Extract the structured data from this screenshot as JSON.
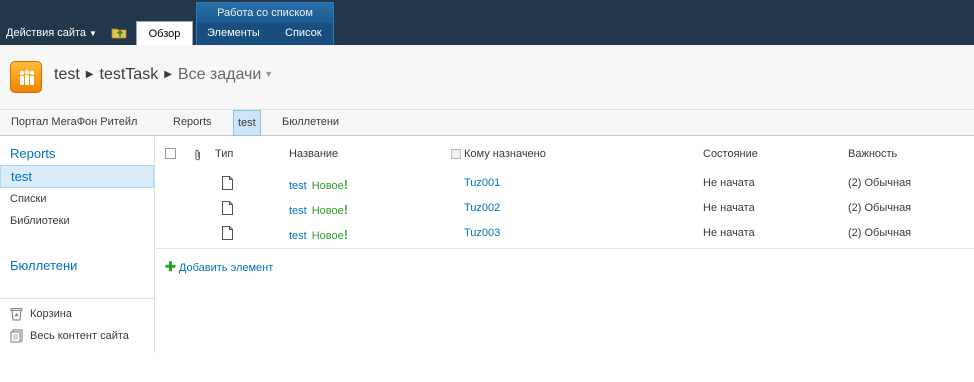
{
  "ribbon": {
    "site_actions": "Действия сайта",
    "browse_tab": "Обзор",
    "context_group": "Работа со списком",
    "context_tabs": [
      "Элементы",
      "Список"
    ]
  },
  "breadcrumb": {
    "site": "test",
    "list": "testTask",
    "view": "Все задачи"
  },
  "topnav": [
    "Портал МегаФон Ритейл",
    "Reports",
    "test",
    "Бюллетени"
  ],
  "quicklaunch": {
    "reports": "Reports",
    "selected": "test",
    "lists": "Списки",
    "libraries": "Библиотеки",
    "bulletins": "Бюллетени",
    "recycle_bin": "Корзина",
    "all_content": "Весь контент сайта"
  },
  "list": {
    "columns": {
      "type": "Тип",
      "title": "Название",
      "assigned": "Кому назначено",
      "status": "Состояние",
      "priority": "Важность"
    },
    "new_label": "Новое",
    "new_mark": "!",
    "rows": [
      {
        "title": "test",
        "assigned": "Tuz001",
        "status": "Не начата",
        "priority": "(2) Обычная"
      },
      {
        "title": "test",
        "assigned": "Tuz002",
        "status": "Не начата",
        "priority": "(2) Обычная"
      },
      {
        "title": "test",
        "assigned": "Tuz003",
        "status": "Не начата",
        "priority": "(2) Обычная"
      }
    ],
    "add_item": "Добавить элемент"
  }
}
